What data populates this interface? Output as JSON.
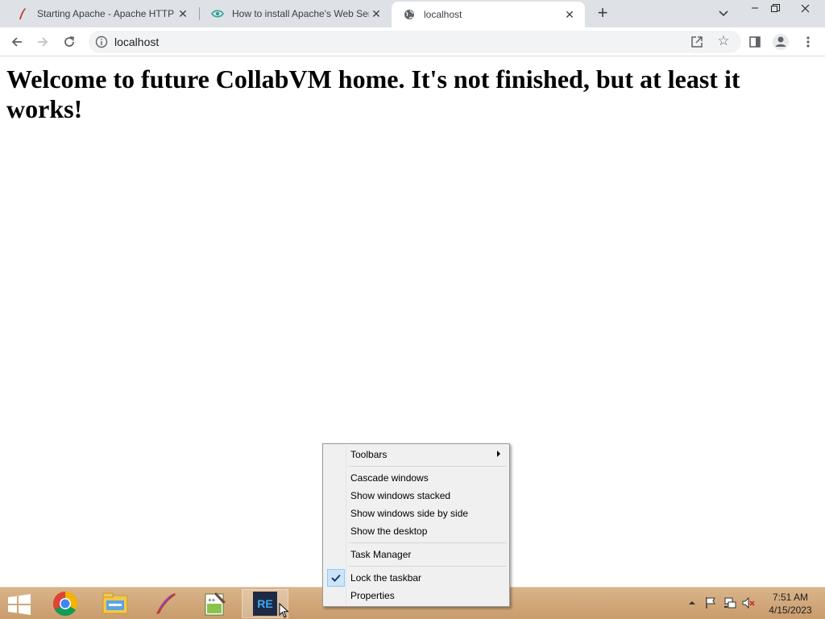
{
  "browser": {
    "tabs": [
      {
        "title": "Starting Apache - Apache HTTP S",
        "favicon": "apache-feather-icon"
      },
      {
        "title": "How to install Apache's Web Ser",
        "favicon": "eye-icon"
      },
      {
        "title": "localhost",
        "favicon": "globe-icon",
        "active": true
      }
    ],
    "new_tab_label": "+",
    "address": {
      "url": "localhost",
      "icon": "info-icon"
    }
  },
  "page": {
    "heading": "Welcome to future CollabVM home. It's not finished, but at least it works!"
  },
  "context_menu": {
    "items": [
      {
        "label": "Toolbars",
        "submenu": true
      },
      {
        "label": "Cascade windows"
      },
      {
        "label": "Show windows stacked"
      },
      {
        "label": "Show windows side by side"
      },
      {
        "label": "Show the desktop"
      },
      {
        "label": "Task Manager"
      },
      {
        "label": "Lock the taskbar",
        "checked": true
      },
      {
        "label": "Properties"
      }
    ]
  },
  "taskbar": {
    "apps": [
      "chrome-icon",
      "file-explorer-icon",
      "apache-feather-icon",
      "notepad-plus-plus-icon",
      "re-pack-icon"
    ],
    "re_label": "RE",
    "clock": {
      "time": "7:51 AM",
      "date": "4/15/2023"
    }
  },
  "colors": {
    "taskbar": "#c99c6c",
    "tab_strip": "#dee1e6",
    "menu_background": "#f0f0f0",
    "check_highlight": "#cce4f7"
  }
}
